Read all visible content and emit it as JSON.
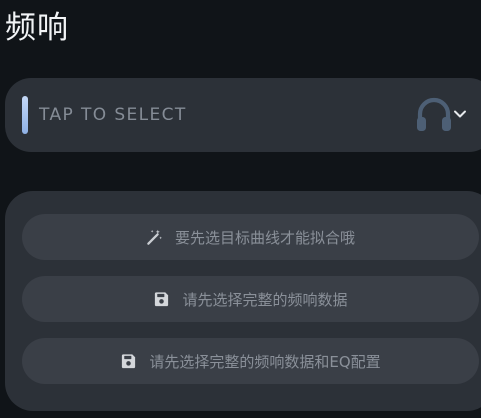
{
  "header": {
    "title": "频响"
  },
  "device_select": {
    "label": "TAP TO SELECT",
    "accent_color": "#a9c4ee",
    "icons": [
      "headphones-icon",
      "chevron-down-icon"
    ]
  },
  "actions": [
    {
      "label": "要先选目标曲线才能拟合哦",
      "icon": "magic-wand-icon"
    },
    {
      "label": "请先选择完整的频响数据",
      "icon": "save-icon"
    },
    {
      "label": "请先选择完整的频响数据和EQ配置",
      "icon": "save-icon"
    }
  ],
  "colors": {
    "background": "#101418",
    "card": "#2c3138",
    "button": "#3a3f47",
    "muted_text": "#8a9099",
    "headphones": "#4d5f75"
  }
}
